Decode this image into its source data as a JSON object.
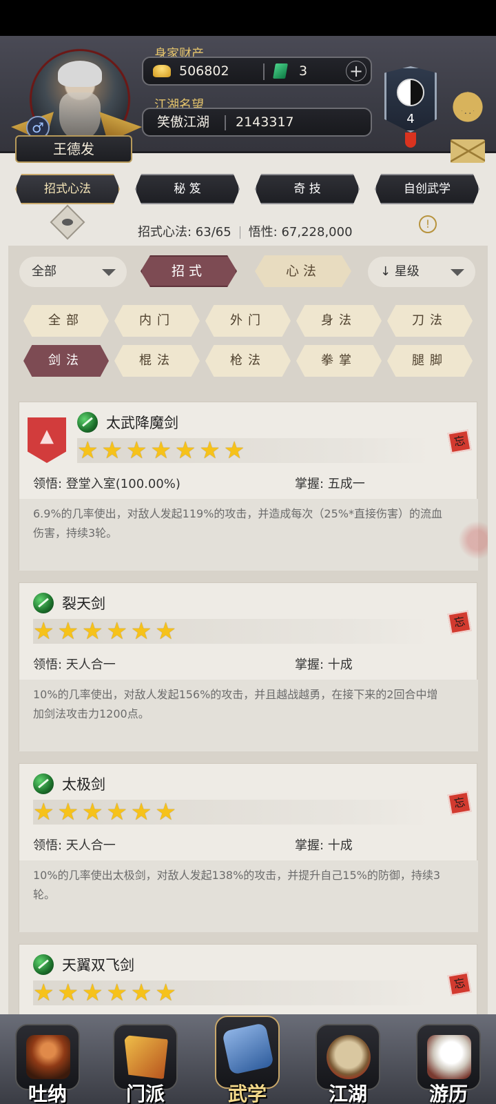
{
  "header": {
    "player_name": "王德发",
    "gender_symbol": "♂",
    "wealth_label": "身家财产",
    "gold": "506802",
    "jade": "3",
    "plus": "+",
    "fame_label": "江湖名望",
    "fame_title": "笑傲江湖",
    "fame_value": "2143317",
    "badge_level": "4"
  },
  "top_tabs": [
    {
      "label": "招式心法",
      "active": true
    },
    {
      "label": "秘 笈",
      "active": false
    },
    {
      "label": "奇 技",
      "active": false
    },
    {
      "label": "自创武学",
      "active": false
    }
  ],
  "stats": {
    "moves": "招式心法: 63/65",
    "insight": "悟性: 67,228,000",
    "info": "!"
  },
  "filters": {
    "scope": "全部",
    "seg_moves": "招式",
    "seg_heart": "心法",
    "sort": "↓ 星级"
  },
  "categories": [
    {
      "label": "全部",
      "active": false
    },
    {
      "label": "内门",
      "active": false
    },
    {
      "label": "外门",
      "active": false
    },
    {
      "label": "身法",
      "active": false
    },
    {
      "label": "刀法",
      "active": false
    },
    {
      "label": "剑法",
      "active": true
    },
    {
      "label": "棍法",
      "active": false
    },
    {
      "label": "枪法",
      "active": false
    },
    {
      "label": "拳掌",
      "active": false
    },
    {
      "label": "腿脚",
      "active": false
    }
  ],
  "skills": [
    {
      "name": "太武降魔剑",
      "stars": 7,
      "stars_text": "★★★★★★★",
      "comprehension": "领悟: 登堂入室(100.00%)",
      "mastery": "掌握: 五成一",
      "desc": "6.9%的几率使出，对敌人发起119%的攻击，并造成每次（25%*直接伤害）的流血伤害，持续3轮。",
      "forget": "忘",
      "has_rank_badge": true
    },
    {
      "name": "裂天剑",
      "stars": 6,
      "stars_text": "★★★★★★",
      "comprehension": "领悟: 天人合一",
      "mastery": "掌握: 十成",
      "desc": "10%的几率使出，对敌人发起156%的攻击，并且越战越勇，在接下来的2回合中增加剑法攻击力1200点。",
      "forget": "忘",
      "has_rank_badge": false
    },
    {
      "name": "太极剑",
      "stars": 6,
      "stars_text": "★★★★★★",
      "comprehension": "领悟: 天人合一",
      "mastery": "掌握: 十成",
      "desc": "10%的几率使出太极剑，对敌人发起138%的攻击，并提升自己15%的防御，持续3轮。",
      "forget": "忘",
      "has_rank_badge": false
    },
    {
      "name": "天翼双飞剑",
      "stars": 6,
      "stars_text": "★★★★★★",
      "comprehension": "",
      "mastery": "",
      "desc": "",
      "forget": "忘",
      "has_rank_badge": false
    }
  ],
  "bottom_nav": [
    {
      "label": "吐纳",
      "icon": "meditate-icon",
      "color": "#c2642a",
      "active": false
    },
    {
      "label": "门派",
      "icon": "sect-banner-icon",
      "color": "#d89a2a",
      "active": false
    },
    {
      "label": "武学",
      "icon": "martial-book-icon",
      "color": "#3d6fb0",
      "active": true
    },
    {
      "label": "江湖",
      "icon": "straw-hat-icon",
      "color": "#b8a27a",
      "active": false
    },
    {
      "label": "游历",
      "icon": "white-horse-icon",
      "color": "#d9d4cc",
      "active": false
    }
  ]
}
